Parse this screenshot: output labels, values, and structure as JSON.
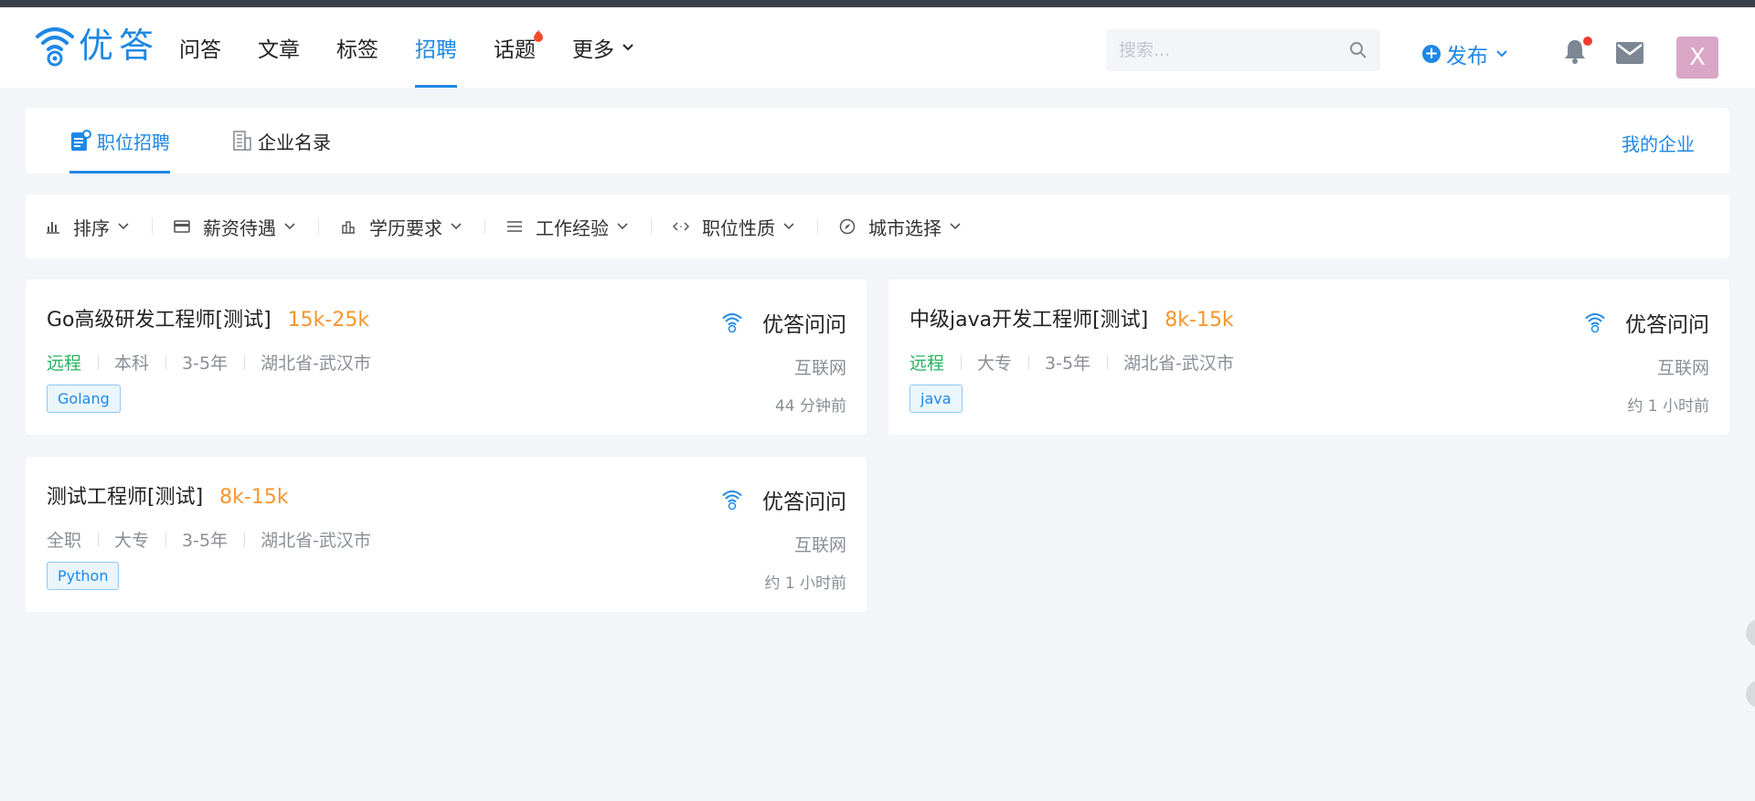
{
  "header": {
    "logo_text": "优答",
    "nav": [
      {
        "label": "问答"
      },
      {
        "label": "文章"
      },
      {
        "label": "标签"
      },
      {
        "label": "招聘"
      },
      {
        "label": "话题"
      },
      {
        "label": "更多"
      }
    ],
    "active_nav": "招聘",
    "search_placeholder": "搜索...",
    "publish_label": "发布",
    "avatar_letter": "X",
    "colors": {
      "accent": "#1e88e5",
      "avatar_bg": "#d9a6c6",
      "notification_dot": "#f23c2f"
    }
  },
  "tabs": {
    "items": [
      {
        "label": "职位招聘",
        "icon": "job-post-icon"
      },
      {
        "label": "企业名录",
        "icon": "building-icon"
      }
    ],
    "active": "职位招聘",
    "my_company": "我的企业"
  },
  "filters": [
    {
      "label": "排序",
      "icon": "sort-bars-icon"
    },
    {
      "label": "薪资待遇",
      "icon": "card-icon"
    },
    {
      "label": "学历要求",
      "icon": "education-icon"
    },
    {
      "label": "工作经验",
      "icon": "list-lines-icon"
    },
    {
      "label": "职位性质",
      "icon": "code-arrows-icon"
    },
    {
      "label": "城市选择",
      "icon": "compass-icon"
    }
  ],
  "jobs": [
    {
      "title": "Go高级研发工程师[测试]",
      "salary": "15k-25k",
      "type": "远程",
      "education": "本科",
      "experience": "3-5年",
      "location": "湖北省-武汉市",
      "tag": "Golang",
      "company": "优答问问",
      "industry": "互联网",
      "time": "44 分钟前"
    },
    {
      "title": "中级java开发工程师[测试]",
      "salary": "8k-15k",
      "type": "远程",
      "education": "大专",
      "experience": "3-5年",
      "location": "湖北省-武汉市",
      "tag": "java",
      "company": "优答问问",
      "industry": "互联网",
      "time": "约 1 小时前"
    },
    {
      "title": "测试工程师[测试]",
      "salary": "8k-15k",
      "type": "全职",
      "education": "大专",
      "experience": "3-5年",
      "location": "湖北省-武汉市",
      "tag": "Python",
      "company": "优答问问",
      "industry": "互联网",
      "time": "约 1 小时前"
    }
  ]
}
